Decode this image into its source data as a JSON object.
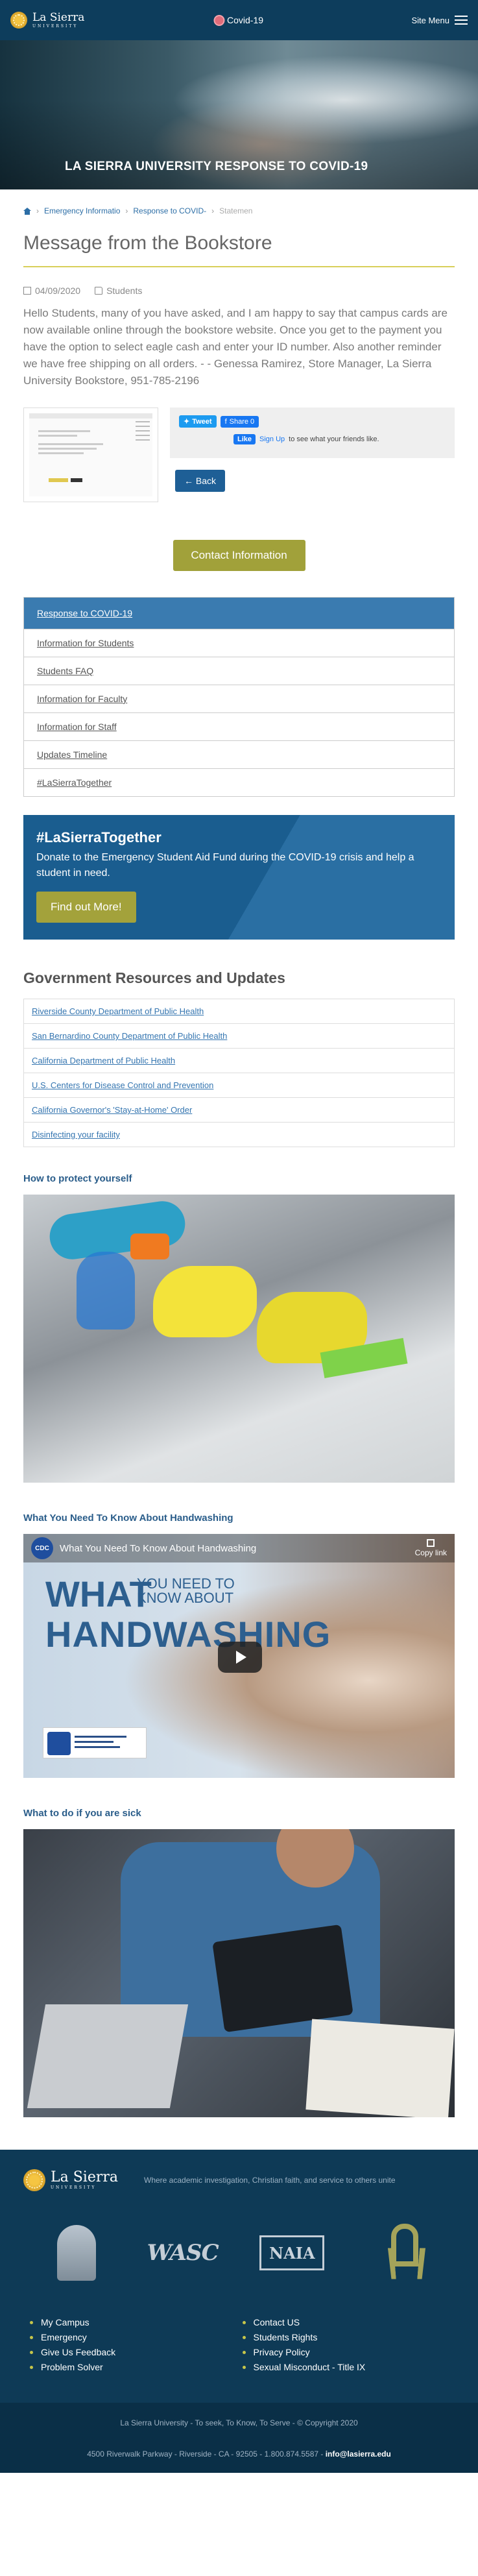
{
  "header": {
    "logo_main": "La Sierra",
    "logo_sub": "UNIVERSITY",
    "covid_link": "Covid-19",
    "menu_label": "Site Menu"
  },
  "hero": {
    "title": "LA SIERRA UNIVERSITY RESPONSE TO COVID-19"
  },
  "breadcrumbs": [
    {
      "label": "Emergency Informatio"
    },
    {
      "label": "Response to COVID-"
    },
    {
      "label": "Statemen"
    }
  ],
  "article": {
    "title": "Message from the Bookstore",
    "date": "04/09/2020",
    "category": "Students",
    "body": "Hello Students, many of you have asked, and I am happy to say that campus cards are now available online through the bookstore website. Once you get to the payment you have the option to select eagle cash and enter your ID number. Also another reminder we have free shipping on all orders. - - Genessa Ramirez, Store Manager, La Sierra University Bookstore, 951-785-2196"
  },
  "share": {
    "tweet": "Tweet",
    "fb_share": "Share 0",
    "like": "Like",
    "signup": "Sign Up",
    "signup_rest": "to see what your friends like."
  },
  "buttons": {
    "back": "← Back",
    "contact": "Contact Information"
  },
  "covid_panel": {
    "header": "Response to COVID-19",
    "items": [
      {
        "label": "Information for Students"
      },
      {
        "label": "Students FAQ"
      },
      {
        "label": "Information for Faculty"
      },
      {
        "label": "Information for Staff"
      },
      {
        "label": "Updates Timeline"
      },
      {
        "label": "#LaSierraTogether"
      }
    ]
  },
  "cta": {
    "title": "#LaSierraTogether",
    "text": "Donate to the Emergency Student Aid Fund during the COVID-19 crisis and help a student in need.",
    "button": "Find out More!"
  },
  "government": {
    "title": "Government Resources and Updates",
    "items": [
      {
        "label": "Riverside County Department of Public Health"
      },
      {
        "label": "San Bernardino County Department of Public Health"
      },
      {
        "label": "California Department of Public Health"
      },
      {
        "label": "U.S. Centers for Disease Control and Prevention"
      },
      {
        "label": "California Governor's 'Stay-at-Home' Order"
      },
      {
        "label": "Disinfecting your facility"
      }
    ]
  },
  "sections": {
    "protect": "How to protect yourself",
    "handwashing": "What You Need To Know About Handwashing",
    "sick": "What to do if you are sick"
  },
  "video": {
    "channel": "CDC",
    "title": "What You Need To Know About Handwashing",
    "copy_link": "Copy link",
    "word_what": "WHAT",
    "word_need": "YOU NEED TO",
    "word_know": "KNOW ABOUT",
    "word_hand": "HANDWASHING"
  },
  "footer": {
    "logo_main": "La Sierra",
    "logo_sub": "UNIVERSITY",
    "tagline": "Where academic investigation, Christian faith, and service to others unite",
    "badge_wasc": "WASC",
    "badge_naia": "NAIA",
    "links_left": [
      {
        "label": "My Campus"
      },
      {
        "label": "Emergency"
      },
      {
        "label": "Give Us Feedback"
      },
      {
        "label": "Problem Solver"
      }
    ],
    "links_right": [
      {
        "label": "Contact US"
      },
      {
        "label": "Students Rights"
      },
      {
        "label": "Privacy Policy"
      },
      {
        "label": "Sexual Misconduct - Title IX"
      }
    ],
    "motto": "La Sierra University - To seek, To Know, To Serve - © Copyright 2020",
    "address": "4500 Riverwalk Parkway - Riverside - CA - 92505 - 1.800.874.5587 - ",
    "email": "info@lasierra.edu"
  }
}
